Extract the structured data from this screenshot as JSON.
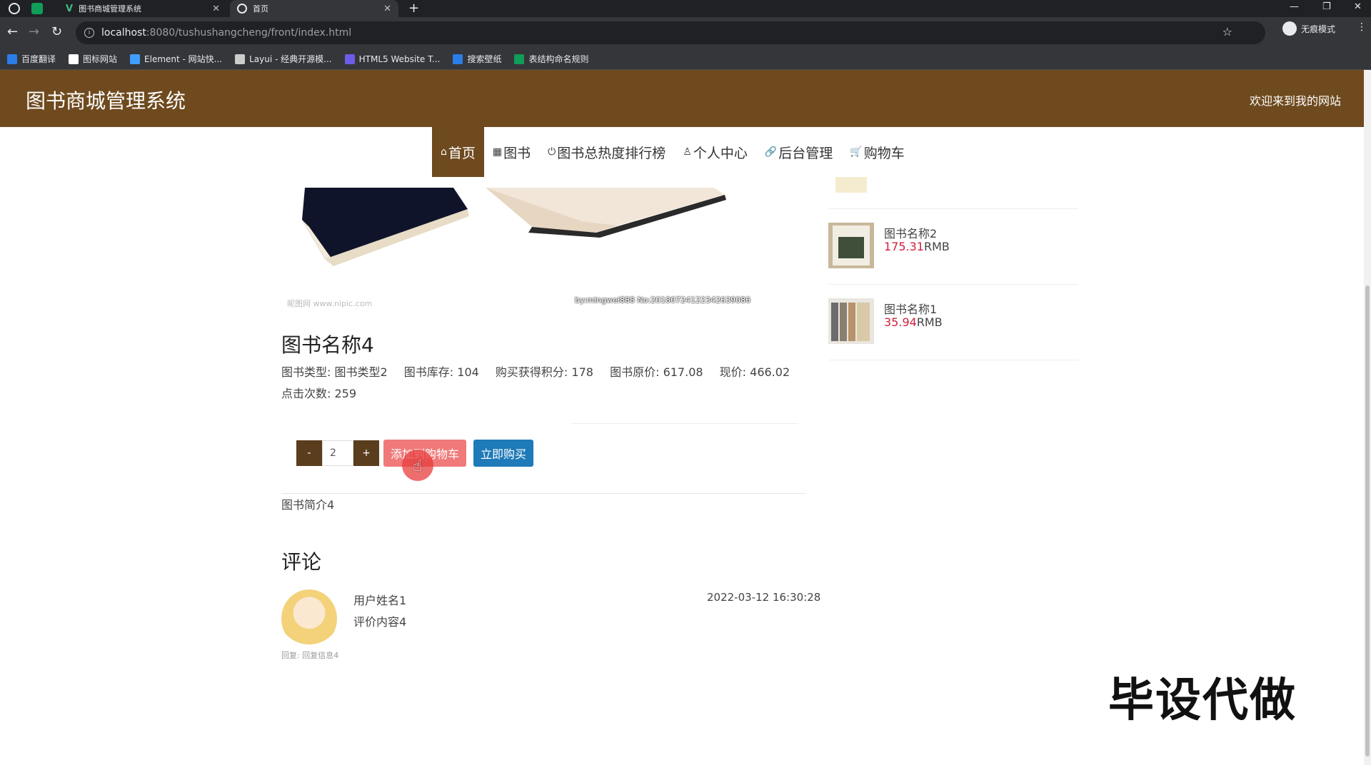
{
  "browser": {
    "tabs": [
      {
        "title": "图书商城管理系统"
      },
      {
        "title": "首页"
      }
    ],
    "url_host": "localhost",
    "url_path": ":8080/tushushangcheng/front/index.html",
    "profile_label": "无痕模式",
    "bookmarks": [
      {
        "label": "百度翻译",
        "color": "#2b7de9"
      },
      {
        "label": "图标网站",
        "color": "#ffffff"
      },
      {
        "label": "Element - 网站快...",
        "color": "#409eff"
      },
      {
        "label": "Layui - 经典开源模...",
        "color": "#cccccc"
      },
      {
        "label": "HTML5 Website T...",
        "color": "#6d5ce7"
      },
      {
        "label": "搜索壁纸",
        "color": "#2b7de9"
      },
      {
        "label": "表结构命名规则",
        "color": "#0f9d58"
      }
    ]
  },
  "header": {
    "site_title": "图书商城管理系统",
    "welcome": "欢迎来到我的网站"
  },
  "nav": [
    {
      "label": "首页",
      "icon": "home-icon"
    },
    {
      "label": "图书",
      "icon": "grid-icon"
    },
    {
      "label": "图书总热度排行榜",
      "icon": "power-icon"
    },
    {
      "label": "个人中心",
      "icon": "user-icon"
    },
    {
      "label": "后台管理",
      "icon": "link-icon"
    },
    {
      "label": "购物车",
      "icon": "cart-icon"
    }
  ],
  "image_watermark": {
    "left": "昵图网 www.nipic.com",
    "right": "by:mingwei888 No:20180724122342639086"
  },
  "book": {
    "title": "图书名称4",
    "type_label": "图书类型:",
    "type_value": "图书类型2",
    "stock_label": "图书库存:",
    "stock_value": "104",
    "points_label": "购买获得积分:",
    "points_value": "178",
    "orig_price_label": "图书原价:",
    "orig_price_value": "617.08",
    "price_label": "现价:",
    "price_value": "466.02",
    "clicks_label": "点击次数:",
    "clicks_value": "259",
    "quantity": "2",
    "minus_label": "-",
    "plus_label": "+",
    "add_cart_label": "添加到购物车",
    "buy_now_label": "立即购买",
    "intro": "图书简介4"
  },
  "comments": {
    "title": "评论",
    "items": [
      {
        "user": "用户姓名1",
        "content": "评价内容4",
        "time": "2022-03-12 16:30:28",
        "reply": "回复:  回复信息4"
      }
    ]
  },
  "sidebar": {
    "items": [
      {
        "name": "图书名称2",
        "price": "175.31",
        "currency": "RMB"
      },
      {
        "name": "图书名称1",
        "price": "35.94",
        "currency": "RMB"
      }
    ]
  },
  "overlay_text": "毕设代做",
  "colors": {
    "brand_brown": "#6e4a1e",
    "price_red": "#d0203a",
    "add_cart_pink": "#f07a7a",
    "buy_blue": "#1e7ab8"
  }
}
